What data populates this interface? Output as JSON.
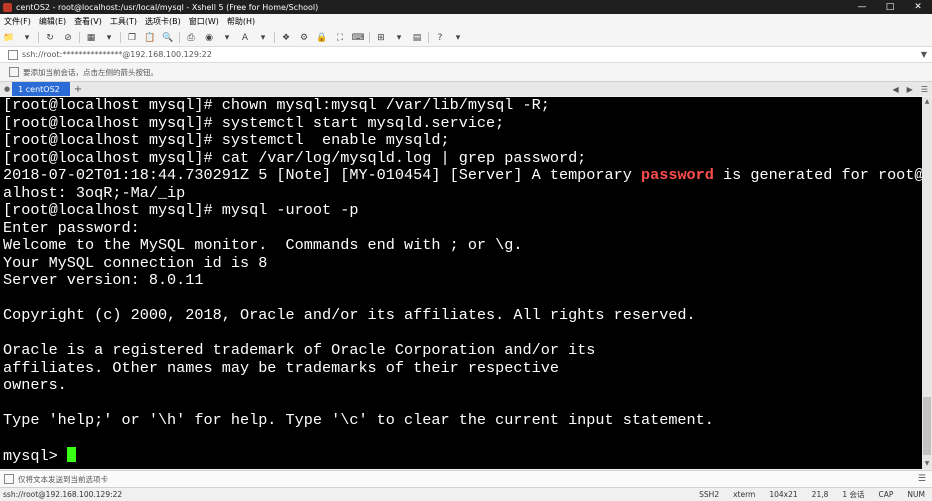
{
  "window": {
    "title": "centOS2 - root@localhost:/usr/local/mysql - Xshell 5 (Free for Home/School)"
  },
  "menu": [
    "文件(F)",
    "编辑(E)",
    "查看(V)",
    "工具(T)",
    "选项卡(B)",
    "窗口(W)",
    "帮助(H)"
  ],
  "address": {
    "text": "ssh://root:***************@192.168.100.129:22"
  },
  "hint": {
    "text": "要添加当前会话，点击左侧的箭头按钮。"
  },
  "tab": {
    "label": "1 centOS2"
  },
  "terminal": {
    "lines": [
      "[root@localhost mysql]# chown mysql:mysql /var/lib/mysql -R;",
      "[root@localhost mysql]# systemctl start mysqld.service;",
      "[root@localhost mysql]# systemctl  enable mysqld;",
      "[root@localhost mysql]# cat /var/log/mysqld.log | grep password;",
      "",
      "alhost: 3oqR;-Ma/_ip",
      "[root@localhost mysql]# mysql -uroot -p",
      "Enter password:",
      "Welcome to the MySQL monitor.  Commands end with ; or \\g.",
      "Your MySQL connection id is 8",
      "Server version: 8.0.11",
      "",
      "Copyright (c) 2000, 2018, Oracle and/or its affiliates. All rights reserved.",
      "",
      "Oracle is a registered trademark of Oracle Corporation and/or its",
      "affiliates. Other names may be trademarks of their respective",
      "owners.",
      "",
      "Type 'help;' or '\\h' for help. Type '\\c' to clear the current input statement.",
      ""
    ],
    "log_line": {
      "before": "2018-07-02T01:18:44.730291Z 5 [Note] [MY-010454] [Server] A temporary ",
      "highlight": "password",
      "after": " is generated for root@loc"
    },
    "prompt": "mysql> "
  },
  "input_bar": {
    "text": "仅将文本发送到当前选项卡"
  },
  "status": {
    "connection": "ssh://root@192.168.100.129:22",
    "protocol": "SSH2",
    "term": "xterm",
    "size": "104x21",
    "cursor": "21,8",
    "sessions": "1 会话",
    "cap": "CAP",
    "num": "NUM"
  },
  "colors": {
    "highlight": "#ff4e4e",
    "cursor": "#39ff14",
    "tab_active": "#2b6bd6"
  }
}
